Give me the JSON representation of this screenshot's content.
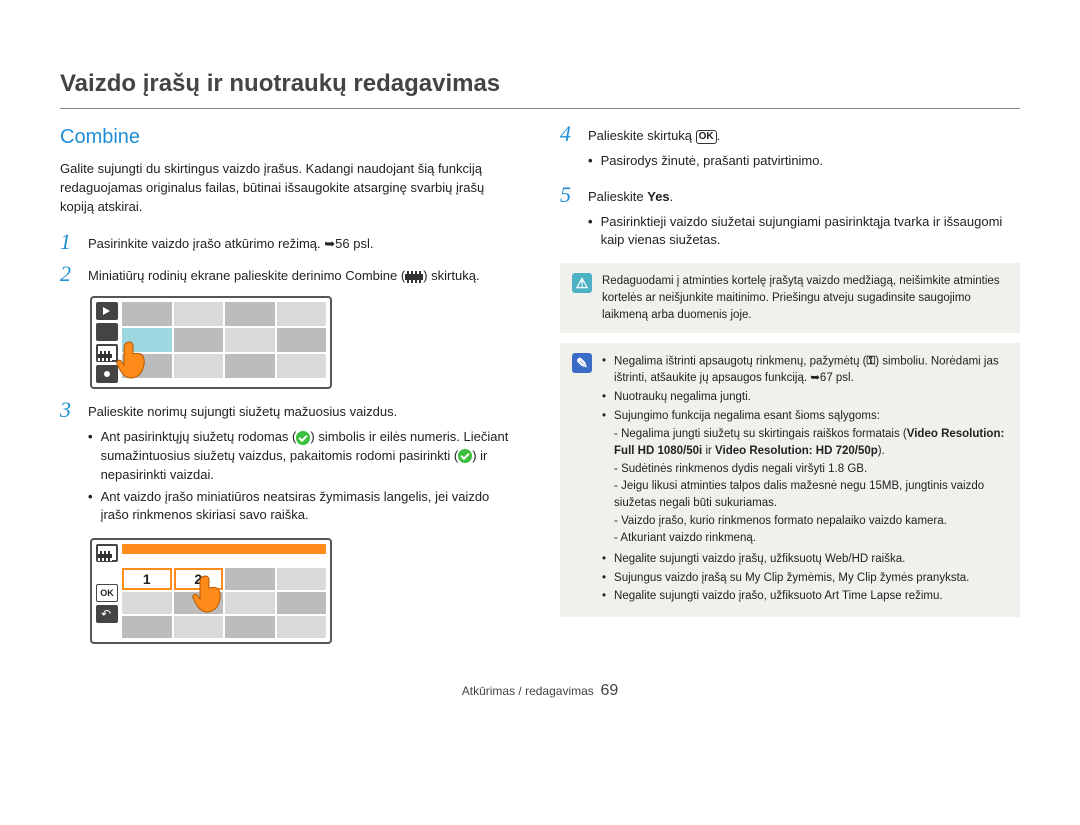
{
  "page_title": "Vaizdo įrašų ir nuotraukų redagavimas",
  "section_title": "Combine",
  "intro": "Galite sujungti du skirtingus vaizdo įrašus. Kadangi naudojant šią funkciją redaguojamas originalus failas, būtinai išsaugokite atsarginę svarbių įrašų kopiją atskirai.",
  "steps": {
    "1": {
      "text_before": "Pasirinkite vaizdo įrašo atkūrimo režimą. ",
      "ref": "56 psl."
    },
    "2": {
      "text_before": "Miniatiūrų rodinių ekrane palieskite derinimo Combine (",
      "text_after": ") skirtuką."
    },
    "3": {
      "text": "Palieskite norimų sujungti siužetų mažuosius vaizdus.",
      "bullets": [
        {
          "a": "Ant pasirinktųjų siužetų rodomas (",
          "b": ") simbolis ir eilės numeris. Liečiant sumažintuosius siužetų vaizdus, pakaitomis rodomi pasirinkti (",
          "c": ") ir nepasirinkti vaizdai."
        },
        {
          "a": "Ant vaizdo įrašo miniatiūros neatsiras žymimasis langelis, jei vaizdo įrašo rinkmenos skiriasi savo raiška."
        }
      ]
    },
    "4": {
      "text_before": "Palieskite skirtuką ",
      "text_after": ".",
      "bullets": [
        "Pasirodys žinutė, prašanti patvirtinimo."
      ]
    },
    "5": {
      "text_before": "Palieskite ",
      "bold": "Yes",
      "text_after": ".",
      "bullets": [
        "Pasirinktieji vaizdo siužetai sujungiami pasirinktąja tvarka ir išsaugomi kaip vienas siužetas."
      ]
    }
  },
  "warning_box": "Redaguodami į atminties kortelę įrašytą vaizdo medžiagą, neišimkite atminties kortelės ar neišjunkite maitinimo. Priešingu atveju sugadinsite saugojimo laikmeną arba duomenis joje.",
  "info_box": {
    "items": [
      {
        "pre": "Negalima ištrinti apsaugotų rinkmenų, pažymėtų (",
        "post": ") simboliu. Norėdami jas ištrinti, atšaukite jų apsaugos funkciją. ",
        "ref": "67 psl."
      },
      {
        "text": "Nuotraukų negalima jungti."
      },
      {
        "text": "Sujungimo funkcija negalima esant šioms sąlygoms:",
        "sub": [
          {
            "pre": "Negalima jungti siužetų su skirtingais raiškos formatais (",
            "bold1": "Video Resolution: Full HD 1080/50i",
            "mid": " ir ",
            "bold2": "Video Resolution: HD 720/50p",
            "post": ")."
          },
          {
            "text": "Sudėtinės rinkmenos dydis negali viršyti 1.8 GB."
          },
          {
            "text": "Jeigu likusi atminties talpos dalis mažesnė negu 15MB, jungtinis vaizdo siužetas negali būti sukuriamas."
          },
          {
            "text": "Vaizdo įrašo, kurio rinkmenos formato nepalaiko vaizdo kamera."
          },
          {
            "text": "Atkuriant vaizdo rinkmeną."
          }
        ]
      },
      {
        "text": "Negalite sujungti vaizdo įrašų, užfiksuotų Web/HD raiška."
      },
      {
        "text": "Sujungus vaizdo įrašą su My Clip žymėmis, My Clip žymės pranyksta."
      },
      {
        "text": "Negalite sujungti vaizdo įrašo, užfiksuoto Art Time Lapse režimu."
      }
    ]
  },
  "footer": {
    "section": "Atkūrimas / redagavimas",
    "page": "69"
  },
  "labels": {
    "ok": "OK",
    "sel1": "1",
    "sel2": "2"
  }
}
